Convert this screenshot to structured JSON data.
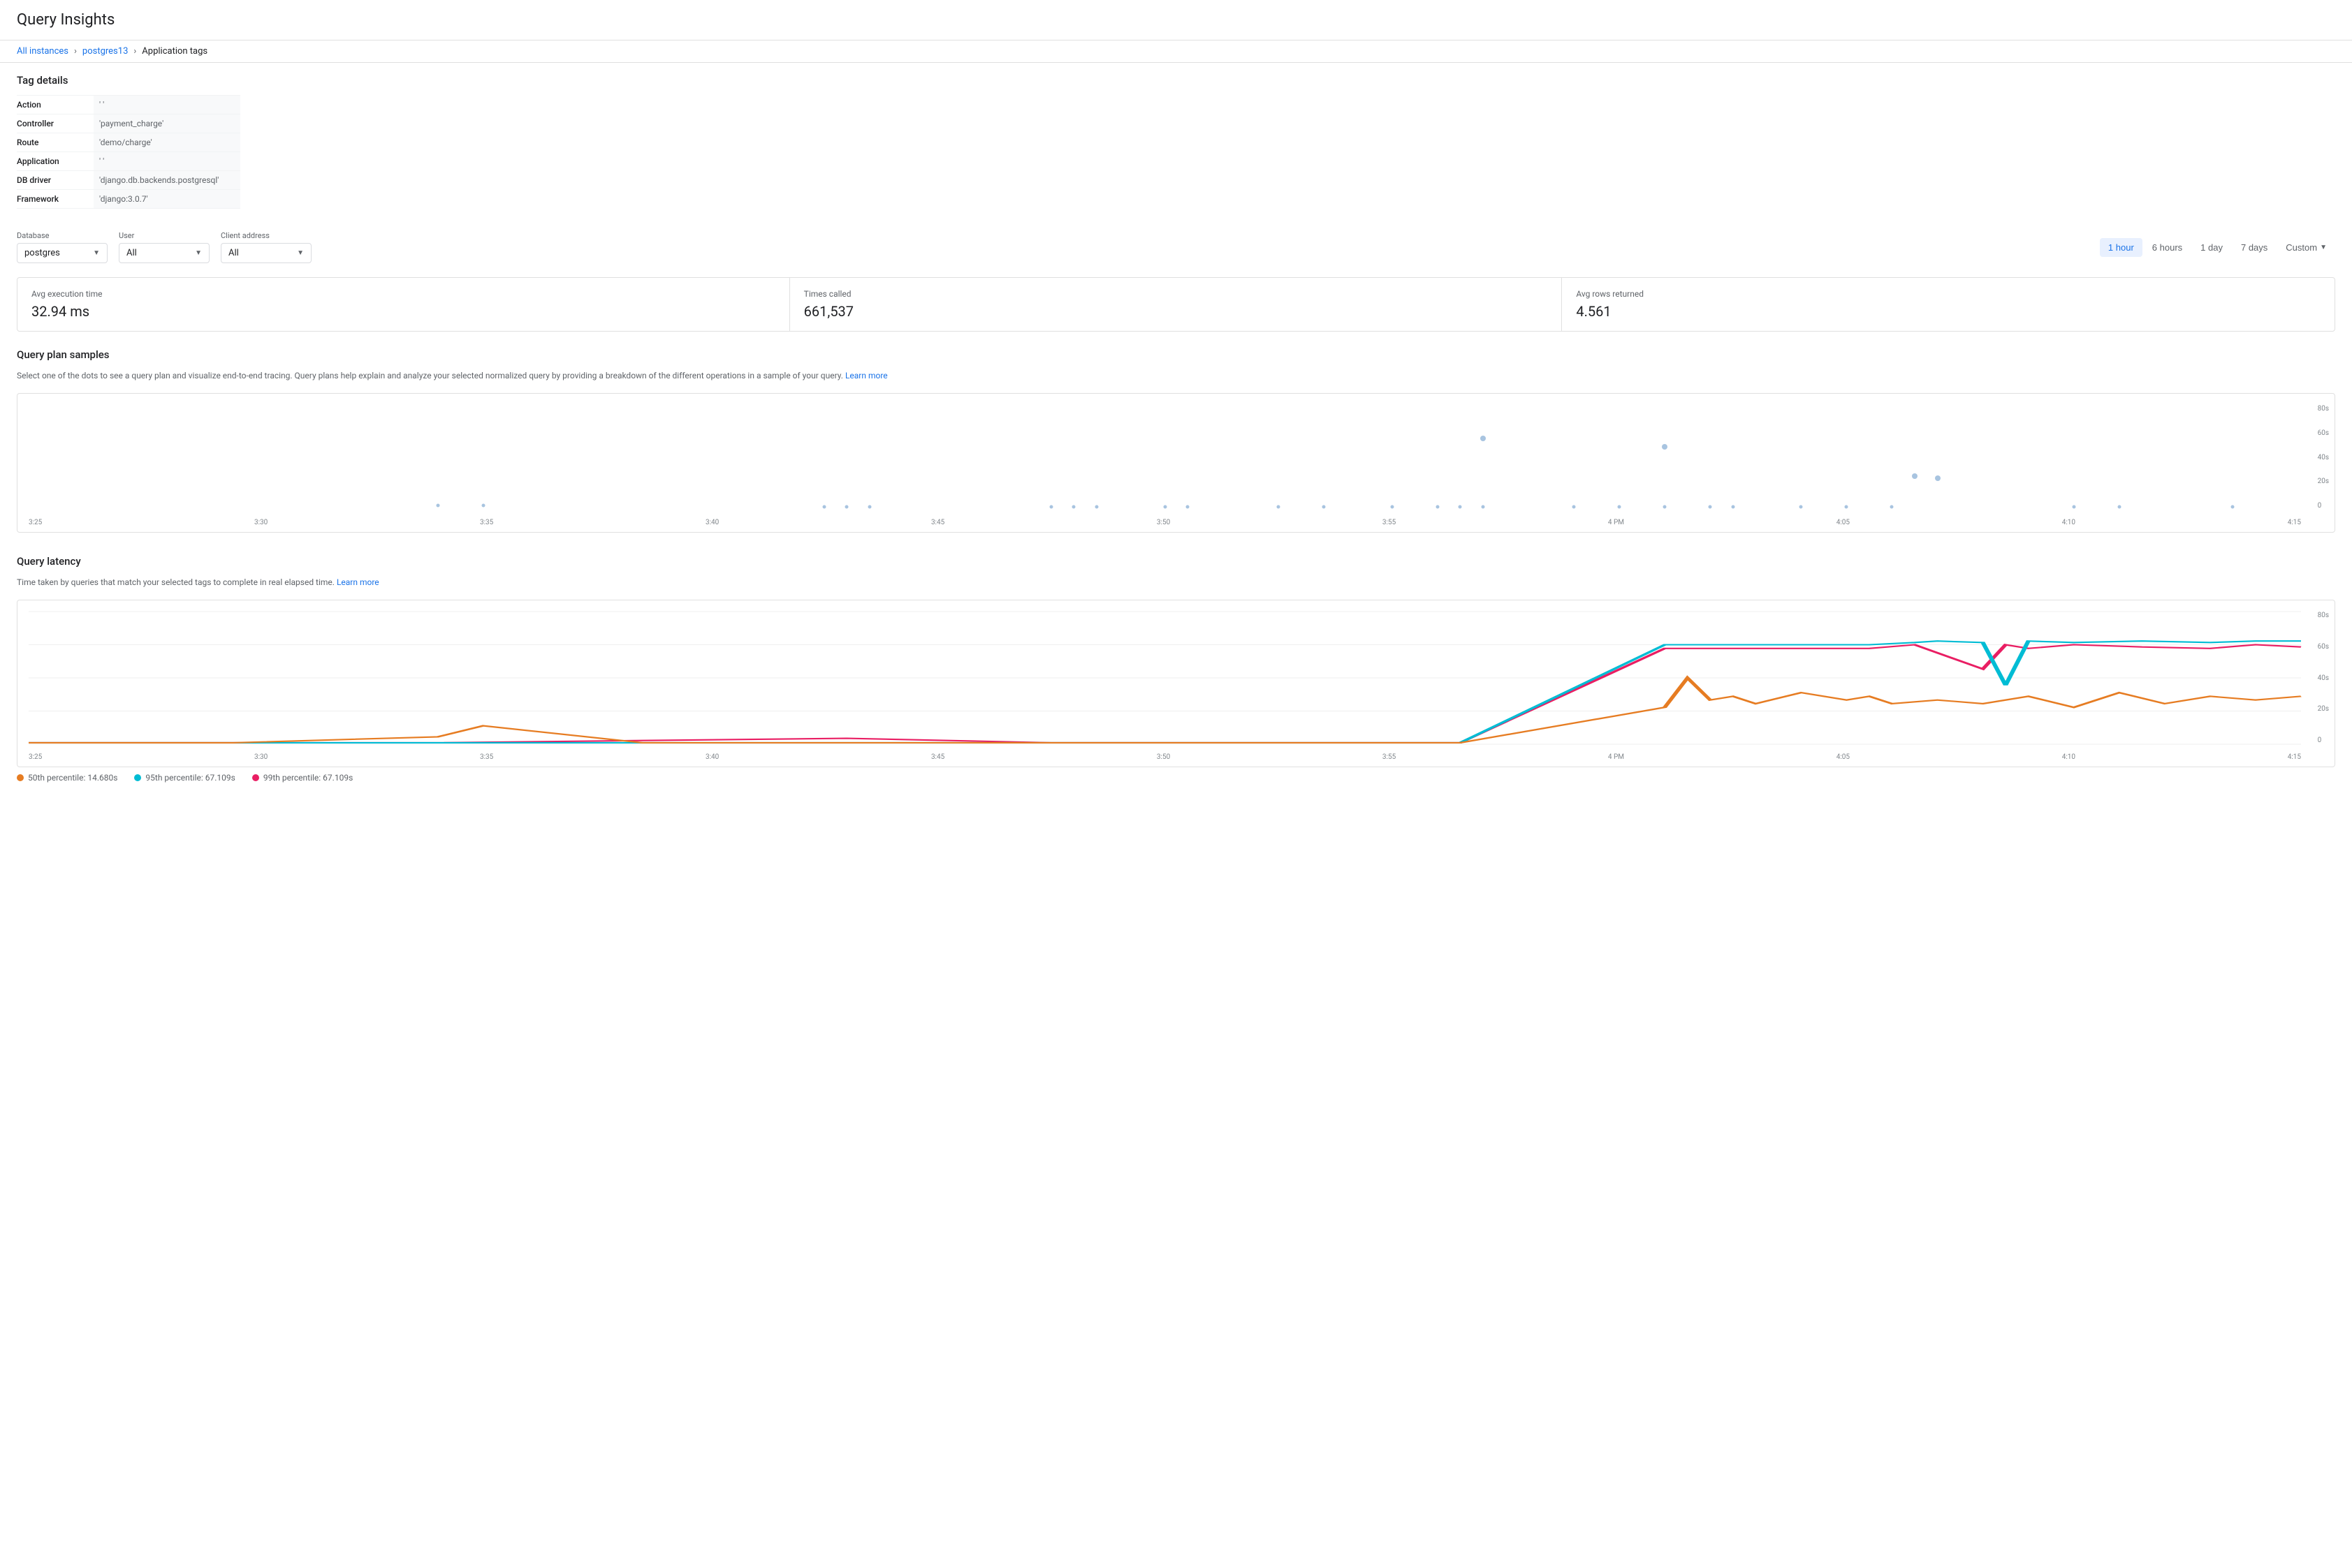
{
  "page": {
    "title": "Query Insights"
  },
  "breadcrumb": {
    "items": [
      {
        "label": "All instances",
        "link": true
      },
      {
        "label": "postgres13",
        "link": true
      },
      {
        "label": "Application tags",
        "link": false
      }
    ]
  },
  "tag_details": {
    "section_title": "Tag details",
    "rows": [
      {
        "label": "Action",
        "value": "' '"
      },
      {
        "label": "Controller",
        "value": "'payment_charge'"
      },
      {
        "label": "Route",
        "value": "'demo/charge'"
      },
      {
        "label": "Application",
        "value": "' '"
      },
      {
        "label": "DB driver",
        "value": "'django.db.backends.postgresql'"
      },
      {
        "label": "Framework",
        "value": "'django:3.0.7'"
      }
    ]
  },
  "filters": {
    "database": {
      "label": "Database",
      "value": "postgres"
    },
    "user": {
      "label": "User",
      "value": "All"
    },
    "client_address": {
      "label": "Client address",
      "value": "All"
    }
  },
  "time_buttons": [
    {
      "label": "1 hour",
      "active": true
    },
    {
      "label": "6 hours",
      "active": false
    },
    {
      "label": "1 day",
      "active": false
    },
    {
      "label": "7 days",
      "active": false
    },
    {
      "label": "Custom",
      "active": false,
      "has_arrow": true
    }
  ],
  "metrics": [
    {
      "label": "Avg execution time",
      "value": "32.94 ms"
    },
    {
      "label": "Times called",
      "value": "661,537"
    },
    {
      "label": "Avg rows returned",
      "value": "4.561"
    }
  ],
  "query_plan_section": {
    "title": "Query plan samples",
    "description": "Select one of the dots to see a query plan and visualize end-to-end tracing. Query plans help explain and analyze your selected normalized query by providing a breakdown of the different operations in a sample of your query.",
    "learn_more": "Learn more",
    "y_labels": [
      "80s",
      "60s",
      "40s",
      "20s",
      "0"
    ],
    "x_labels": [
      "3:25",
      "3:30",
      "3:35",
      "3:40",
      "3:45",
      "3:50",
      "3:55",
      "4 PM",
      "4:05",
      "4:10",
      "4:15"
    ]
  },
  "query_latency_section": {
    "title": "Query latency",
    "description": "Time taken by queries that match your selected tags to complete in real elapsed time.",
    "learn_more": "Learn more",
    "y_labels": [
      "80s",
      "60s",
      "40s",
      "20s",
      "0"
    ],
    "x_labels": [
      "3:25",
      "3:30",
      "3:35",
      "3:40",
      "3:45",
      "3:50",
      "3:55",
      "4 PM",
      "4:05",
      "4:10",
      "4:15"
    ],
    "legend": [
      {
        "label": "50th percentile: 14.680s",
        "color": "orange"
      },
      {
        "label": "95th percentile: 67.109s",
        "color": "teal"
      },
      {
        "label": "99th percentile: 67.109s",
        "color": "pink"
      }
    ]
  }
}
